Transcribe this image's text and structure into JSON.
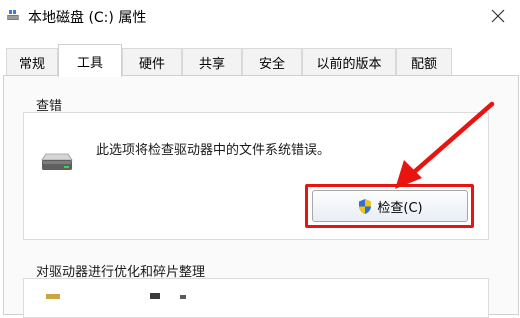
{
  "window": {
    "title": "本地磁盘 (C:) 属性",
    "close_icon": "close-icon",
    "app_icon": "drive-small-icon"
  },
  "tabs": [
    {
      "label": "常规",
      "active": false
    },
    {
      "label": "工具",
      "active": true
    },
    {
      "label": "硬件",
      "active": false
    },
    {
      "label": "共享",
      "active": false
    },
    {
      "label": "安全",
      "active": false
    },
    {
      "label": "以前的版本",
      "active": false
    },
    {
      "label": "配额",
      "active": false
    }
  ],
  "error_check": {
    "group_title": "查错",
    "description": "此选项将检查驱动器中的文件系统错误。",
    "button_label": "检查(C)",
    "drive_icon": "hard-drive-icon",
    "shield_icon": "uac-shield-icon"
  },
  "optimize": {
    "group_title": "对驱动器进行优化和碎片整理"
  },
  "annotation": {
    "color": "#e8140f"
  }
}
